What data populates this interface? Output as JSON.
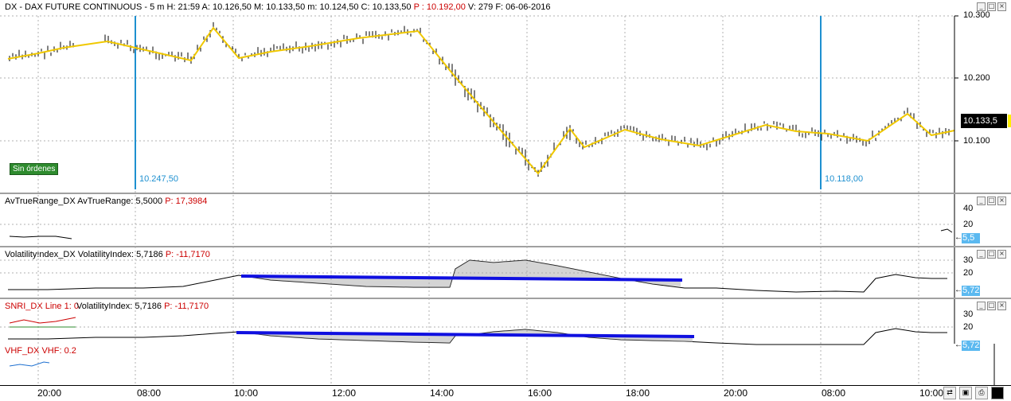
{
  "main_pane": {
    "title_prefix": "DX - DAX FUTURE CONTINUOUS - 5 m H: 21:59 A: 10.126,50 M: 10.133,50 m: 10.124,50 C: 10.133,50",
    "title_p": "P : 10.192,00",
    "title_suffix": "V: 279 F: 06-06-2016",
    "y_ticks": [
      "10.300",
      "10.200",
      "10.100"
    ],
    "current_price": "10.133,5",
    "orders_badge": "Sin órdenes",
    "marker_left": "10.247,50",
    "marker_right": "10.118,00"
  },
  "atr_pane": {
    "title": "AvTrueRange_DX AvTrueRange: 5,5000",
    "title_p": "P: 17,3984",
    "y_ticks": [
      "40",
      "20"
    ],
    "value_box": "5,5"
  },
  "vol_pane": {
    "title": "VolatilityIndex_DX VolatilityIndex: 5,7186",
    "title_p": "P: -11,7170",
    "y_ticks": [
      "30",
      "20"
    ],
    "value_box": "5,72"
  },
  "snri_pane": {
    "title": "SNRI_DX Line 1: 0",
    "overlay_title": "VolatilityIndex: 5,7186",
    "overlay_p": "P: -11,7170",
    "y_ticks": [
      "30",
      "20"
    ],
    "value_box": "5,72"
  },
  "vhf_pane": {
    "title": "VHF_DX VHF: 0.2"
  },
  "x_axis": {
    "ticks": [
      "20:00",
      "08:00",
      "10:00",
      "12:00",
      "14:00",
      "16:00",
      "18:00",
      "20:00",
      "08:00",
      "10:00"
    ]
  },
  "colors": {
    "zigzag": "#f0c800",
    "marker": "#1e90d0",
    "trendline": "#1010e0",
    "negative": "#cc0000",
    "badge": "#2e8b2e"
  }
}
